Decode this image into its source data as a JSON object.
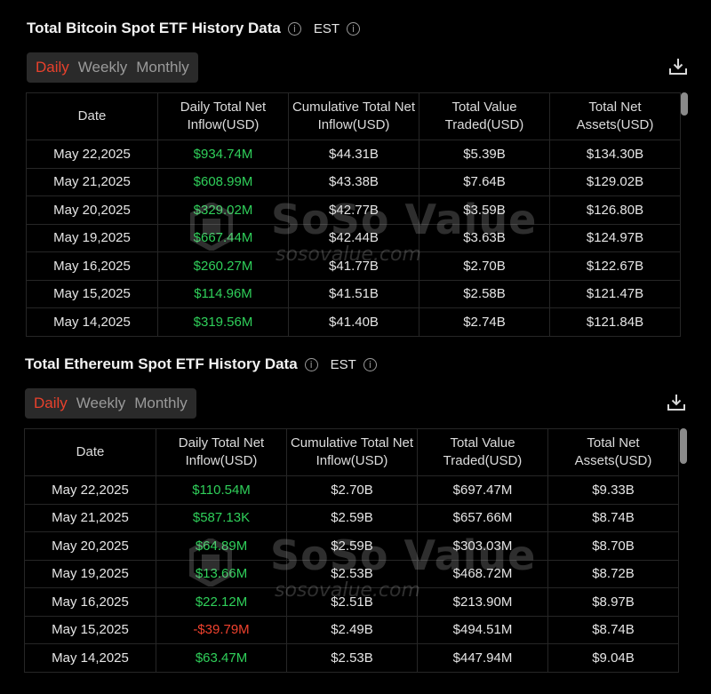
{
  "btc": {
    "title": "Total Bitcoin Spot ETF History Data",
    "timezone": "EST",
    "tabs": [
      "Daily",
      "Weekly",
      "Monthly"
    ],
    "columns": [
      "Date",
      "Daily Total Net Inflow(USD)",
      "Cumulative Total Net Inflow(USD)",
      "Total Value Traded(USD)",
      "Total Net Assets(USD)"
    ],
    "rows": [
      [
        "May 22,2025",
        "$934.74M",
        "$44.31B",
        "$5.39B",
        "$134.30B"
      ],
      [
        "May 21,2025",
        "$608.99M",
        "$43.38B",
        "$7.64B",
        "$129.02B"
      ],
      [
        "May 20,2025",
        "$329.02M",
        "$42.77B",
        "$3.59B",
        "$126.80B"
      ],
      [
        "May 19,2025",
        "$667.44M",
        "$42.44B",
        "$3.63B",
        "$124.97B"
      ],
      [
        "May 16,2025",
        "$260.27M",
        "$41.77B",
        "$2.70B",
        "$122.67B"
      ],
      [
        "May 15,2025",
        "$114.96M",
        "$41.51B",
        "$2.58B",
        "$121.47B"
      ],
      [
        "May 14,2025",
        "$319.56M",
        "$41.40B",
        "$2.74B",
        "$121.84B"
      ]
    ]
  },
  "eth": {
    "title": "Total Ethereum Spot ETF History Data",
    "timezone": "EST",
    "tabs": [
      "Daily",
      "Weekly",
      "Monthly"
    ],
    "columns": [
      "Date",
      "Daily Total Net Inflow(USD)",
      "Cumulative Total Net Inflow(USD)",
      "Total Value Traded(USD)",
      "Total Net Assets(USD)"
    ],
    "rows": [
      [
        "May 22,2025",
        "$110.54M",
        "$2.70B",
        "$697.47M",
        "$9.33B"
      ],
      [
        "May 21,2025",
        "$587.13K",
        "$2.59B",
        "$657.66M",
        "$8.74B"
      ],
      [
        "May 20,2025",
        "$64.89M",
        "$2.59B",
        "$303.03M",
        "$8.70B"
      ],
      [
        "May 19,2025",
        "$13.66M",
        "$2.53B",
        "$468.72M",
        "$8.72B"
      ],
      [
        "May 16,2025",
        "$22.12M",
        "$2.51B",
        "$213.90M",
        "$8.97B"
      ],
      [
        "May 15,2025",
        "-$39.79M",
        "$2.49B",
        "$494.51M",
        "$8.74B"
      ],
      [
        "May 14,2025",
        "$63.47M",
        "$2.53B",
        "$447.94M",
        "$9.04B"
      ]
    ]
  },
  "watermark": {
    "name": "SoSo Value",
    "url": "sosovalue.com"
  },
  "colors": {
    "positive": "#2fcf5a",
    "negative": "#f0422e",
    "active_tab": "#e8412c"
  },
  "icons": [
    "info-icon",
    "download-icon"
  ]
}
